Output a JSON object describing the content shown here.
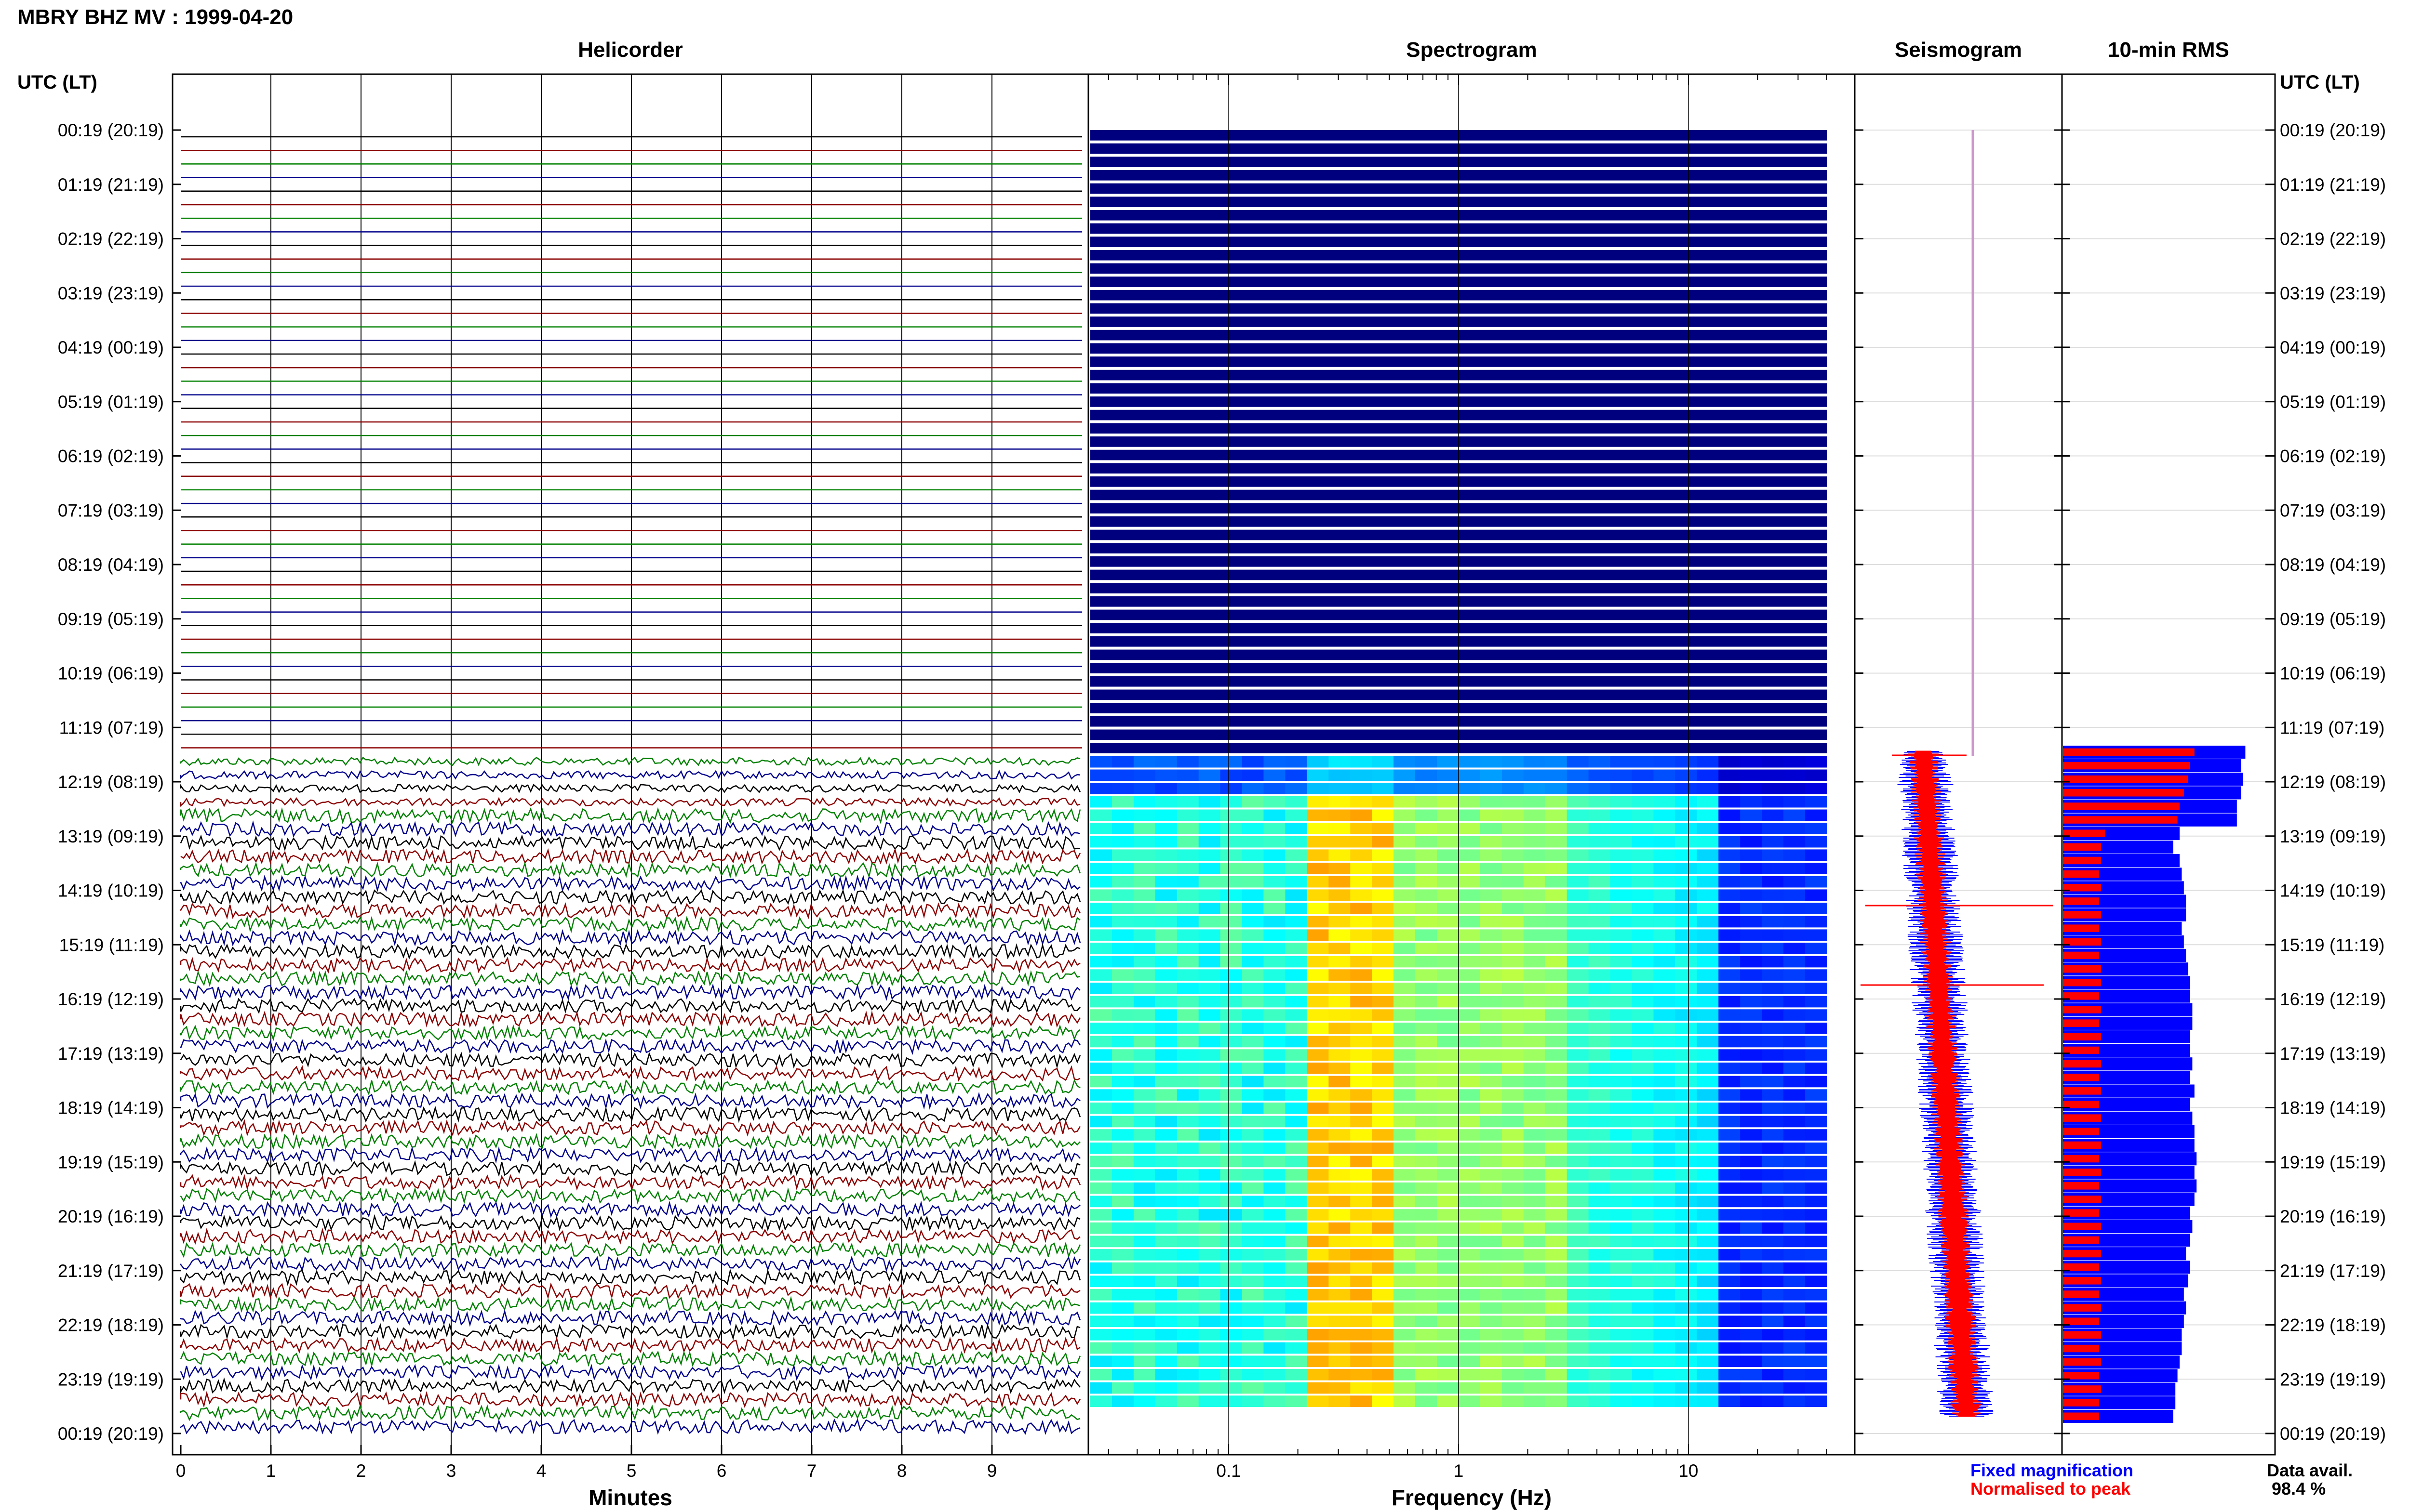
{
  "title": "MBRY BHZ MV : 1999-04-20",
  "panels": {
    "helicorder": "Helicorder",
    "spectrogram": "Spectrogram",
    "seismogram": "Seismogram",
    "rms": "10-min RMS"
  },
  "axis_header_left": "UTC (LT)",
  "axis_header_right": "UTC (LT)",
  "row_labels": [
    "00:19 (20:19)",
    "01:19 (21:19)",
    "02:19 (22:19)",
    "03:19 (23:19)",
    "04:19 (00:19)",
    "05:19 (01:19)",
    "06:19 (02:19)",
    "07:19 (03:19)",
    "08:19 (04:19)",
    "09:19 (05:19)",
    "10:19 (06:19)",
    "11:19 (07:19)",
    "12:19 (08:19)",
    "13:19 (09:19)",
    "14:19 (10:19)",
    "15:19 (11:19)",
    "16:19 (12:19)",
    "17:19 (13:19)",
    "18:19 (14:19)",
    "19:19 (15:19)",
    "20:19 (16:19)",
    "21:19 (17:19)",
    "22:19 (18:19)",
    "23:19 (19:19)",
    "00:19 (20:19)"
  ],
  "legend": {
    "fixed": "Fixed magnification",
    "normalised": "Normalised to peak",
    "fixed_color": "#0000ff",
    "normalised_color": "#ff0000"
  },
  "data_avail": {
    "label": "Data avail.",
    "value": "98.4 %"
  },
  "colors": {
    "trace_cycle": [
      "#000000",
      "#8b0000",
      "#008000",
      "#00008b"
    ],
    "spectro_quiet": "#00007f"
  },
  "chart_data": [
    {
      "type": "line",
      "panel": "helicorder",
      "xlabel": "Minutes",
      "xlim": [
        0,
        10
      ],
      "x_ticks": [
        "0",
        "1",
        "2",
        "3",
        "4",
        "5",
        "6",
        "7",
        "8",
        "9"
      ],
      "x_tick_values": [
        0,
        1,
        2,
        3,
        4,
        5,
        6,
        7,
        8,
        9
      ],
      "rows": 24,
      "note_rows_flat_until_utc": "12:00"
    },
    {
      "type": "heatmap",
      "panel": "spectrogram",
      "xlabel": "Frequency (Hz)",
      "xscale": "log",
      "xlim": [
        0.025,
        40
      ],
      "x_ticks": [
        "0.1",
        "1",
        "10"
      ],
      "x_tick_values": [
        0.1,
        1,
        10
      ]
    },
    {
      "type": "line",
      "panel": "seismogram",
      "series": [
        {
          "name": "Fixed magnification",
          "color": "#0000ff"
        },
        {
          "name": "Normalised to peak",
          "color": "#ff0000"
        }
      ]
    },
    {
      "type": "bar",
      "panel": "rms",
      "orientation": "horizontal",
      "series": [
        {
          "name": "Fixed magnification",
          "color": "#0000ff",
          "values": [
            0.86,
            0.84,
            0.85,
            0.84,
            0.82,
            0.82,
            0.55,
            0.52,
            0.55,
            0.56,
            0.57,
            0.58,
            0.58,
            0.56,
            0.57,
            0.58,
            0.59,
            0.6,
            0.6,
            0.61,
            0.61,
            0.6,
            0.6,
            0.61,
            0.6,
            0.62,
            0.6,
            0.61,
            0.62,
            0.62,
            0.63,
            0.62,
            0.63,
            0.62,
            0.6,
            0.61,
            0.6,
            0.58,
            0.6,
            0.59,
            0.57,
            0.58,
            0.57,
            0.56,
            0.56,
            0.55,
            0.54,
            0.53,
            0.53,
            0.52
          ]
        },
        {
          "name": "Normalised to peak",
          "color": "#ff0000",
          "values": [
            0.62,
            0.6,
            0.59,
            0.57,
            0.55,
            0.54,
            0.2,
            0.18,
            0.18,
            0.17,
            0.18,
            0.17,
            0.18,
            0.17,
            0.18,
            0.17,
            0.18,
            0.18,
            0.17,
            0.18,
            0.17,
            0.18,
            0.17,
            0.18,
            0.17,
            0.18,
            0.17,
            0.18,
            0.17,
            0.18,
            0.17,
            0.18,
            0.17,
            0.18,
            0.17,
            0.18,
            0.17,
            0.18,
            0.17,
            0.18,
            0.17,
            0.18,
            0.17,
            0.18,
            0.17,
            0.18,
            0.17,
            0.18,
            0.17,
            0.17
          ]
        }
      ],
      "data_start_utc": "11:50",
      "bin_minutes": 10
    }
  ]
}
